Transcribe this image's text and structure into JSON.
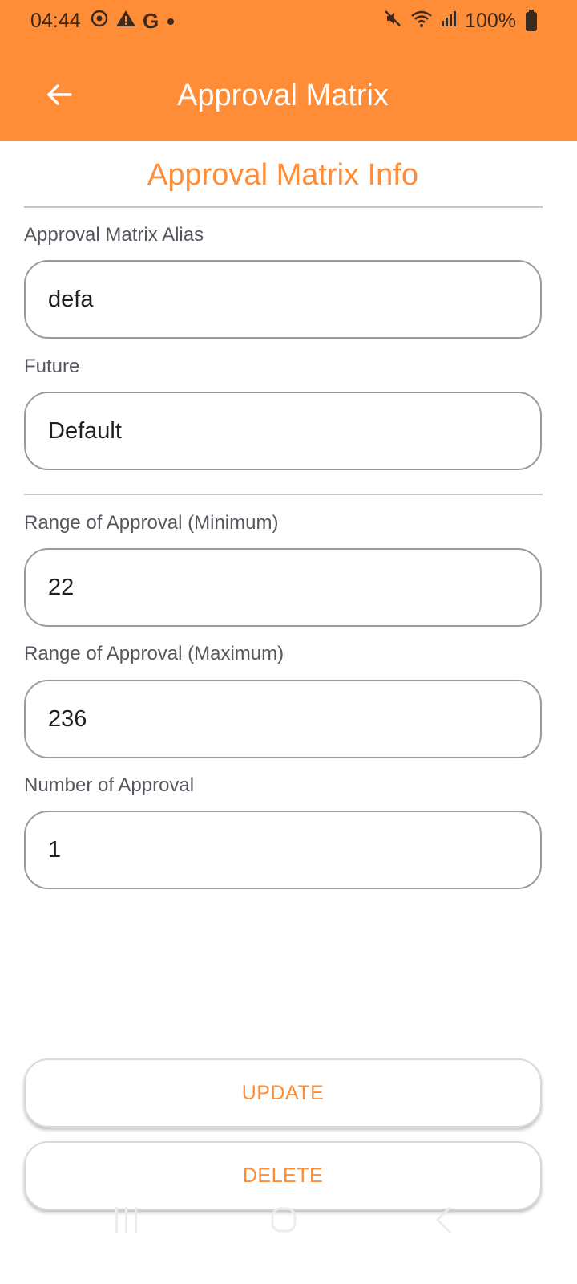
{
  "status_bar": {
    "time": "04:44",
    "battery_pct": "100%",
    "left_icons": [
      "sync-icon",
      "warning-icon",
      "google-icon",
      "dot-icon"
    ],
    "right_icons": [
      "mute-icon",
      "wifi-icon",
      "signal-icon",
      "battery-icon"
    ]
  },
  "app_bar": {
    "title": "Approval Matrix",
    "back_icon": "arrow-left-icon",
    "color": "#FF8C37"
  },
  "form": {
    "section_title": "Approval Matrix Info",
    "alias": {
      "label": "Approval Matrix Alias",
      "value": "defa"
    },
    "future": {
      "label": "Future",
      "value": "Default"
    },
    "range_min": {
      "label": "Range of Approval (Minimum)",
      "value": "22"
    },
    "range_max": {
      "label": "Range of Approval (Maximum)",
      "value": "236"
    },
    "num_approval": {
      "label": "Number of Approval",
      "value": "1"
    }
  },
  "actions": {
    "update_label": "UPDATE",
    "delete_label": "DELETE"
  },
  "system_nav": [
    "recent-apps-icon",
    "home-icon",
    "back-icon"
  ]
}
